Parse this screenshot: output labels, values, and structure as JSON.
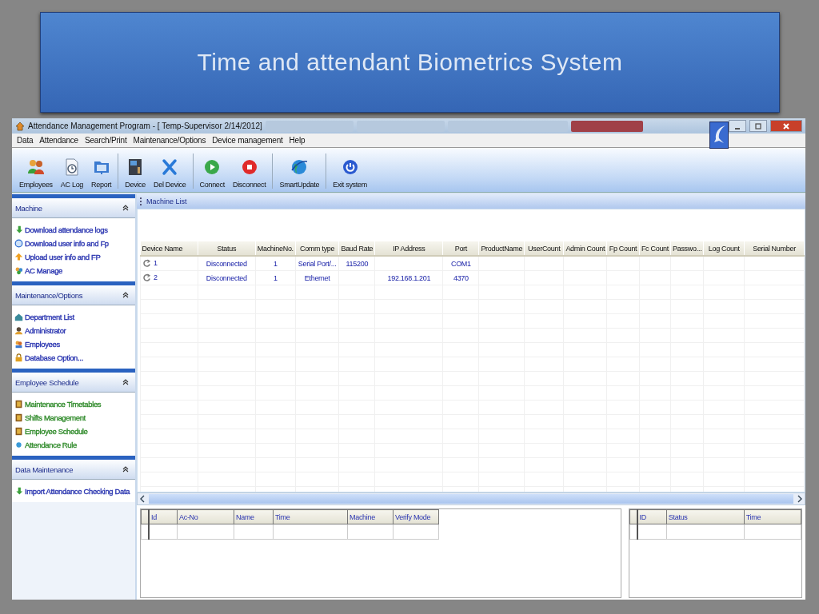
{
  "slide": {
    "title": "Time and attendant Biometrics System"
  },
  "window": {
    "title": "Attendance Management Program - [ Temp-Supervisor 2/14/2012]"
  },
  "taskbar_tabs": [
    {
      "selected": false
    },
    {
      "selected": false
    },
    {
      "selected": false
    },
    {
      "selected": true
    }
  ],
  "menu": [
    "Data",
    "Attendance",
    "Search/Print",
    "Maintenance/Options",
    "Device management",
    "Help"
  ],
  "toolbar": [
    {
      "label": "Employees",
      "separator_after": false
    },
    {
      "label": "AC Log",
      "separator_after": false
    },
    {
      "label": "Report",
      "separator_after": true
    },
    {
      "label": "Device",
      "separator_after": false
    },
    {
      "label": "Del Device",
      "separator_after": true
    },
    {
      "label": "Connect",
      "separator_after": false
    },
    {
      "label": "Disconnect",
      "separator_after": true
    },
    {
      "label": "SmartUpdate",
      "separator_after": true
    },
    {
      "label": "Exit system",
      "separator_after": false
    }
  ],
  "sidebar": {
    "sections": [
      {
        "title": "Machine",
        "expanded": true,
        "items": [
          {
            "label": "Download attendance logs",
            "color": "#2a35b0"
          },
          {
            "label": "Download user info and Fp",
            "color": "#2a35b0"
          },
          {
            "label": "Upload user info and FP",
            "color": "#2a35b0"
          },
          {
            "label": "AC Manage",
            "color": "#2a35b0"
          }
        ]
      },
      {
        "title": "Maintenance/Options",
        "expanded": true,
        "items": [
          {
            "label": "Department List",
            "color": "#2a35b0"
          },
          {
            "label": "Administrator",
            "color": "#2a35b0"
          },
          {
            "label": "Employees",
            "color": "#2a35b0"
          },
          {
            "label": "Database Option...",
            "color": "#2a35b0"
          }
        ]
      },
      {
        "title": "Employee Schedule",
        "expanded": true,
        "items": [
          {
            "label": "Maintenance Timetables",
            "color": "#2f8a2a"
          },
          {
            "label": "Shifts Management",
            "color": "#2f8a2a"
          },
          {
            "label": "Employee Schedule",
            "color": "#2f8a2a"
          },
          {
            "label": "Attendance Rule",
            "color": "#2f8a2a"
          }
        ]
      },
      {
        "title": "Data Maintenance",
        "expanded": true,
        "items": [
          {
            "label": "Import Attendance Checking Data",
            "color": "#2a35b0"
          }
        ]
      }
    ]
  },
  "machine_list": {
    "title": "Machine List",
    "columns": [
      "Device Name",
      "Status",
      "MachineNo.",
      "Comm type",
      "Baud Rate",
      "IP Address",
      "Port",
      "ProductName",
      "UserCount",
      "Admin Count",
      "Fp Count",
      "Fc Count",
      "Passwo...",
      "Log Count",
      "Serial Number"
    ],
    "rows": [
      {
        "cells": [
          "1",
          "Disconnected",
          "1",
          "Serial Port/...",
          "115200",
          null,
          "COM1"
        ]
      },
      {
        "cells": [
          "2",
          "Disconnected",
          "1",
          "Ethernet",
          null,
          "192.168.1.201",
          "4370"
        ]
      }
    ]
  },
  "log_table": {
    "columns": [
      "Id",
      "Ac-No",
      "Name",
      "Time",
      "Machine",
      "Verify Mode"
    ]
  },
  "status_table": {
    "columns": [
      "ID",
      "Status",
      "Time"
    ]
  }
}
